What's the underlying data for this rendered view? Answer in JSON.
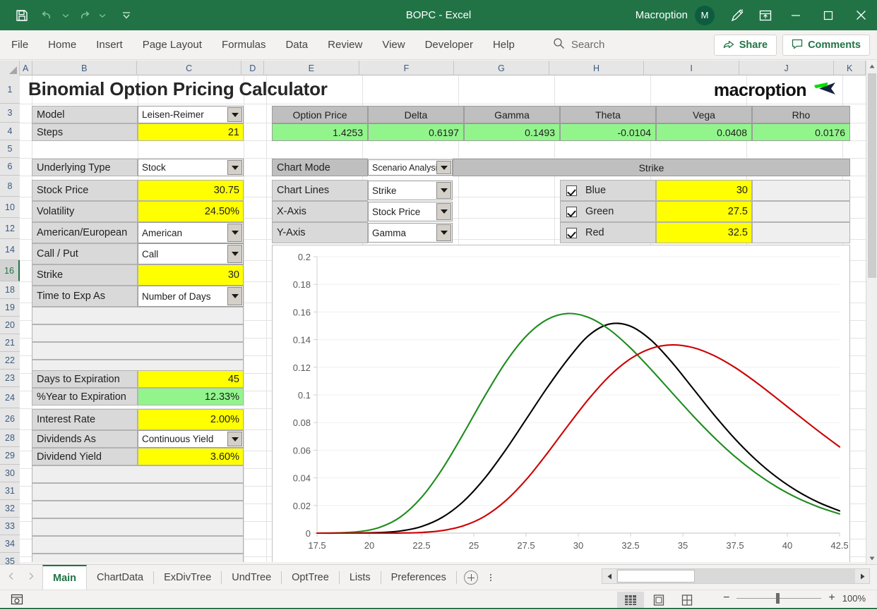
{
  "window": {
    "title": "BOPC  -  Excel",
    "account_name": "Macroption",
    "avatar_initial": "M",
    "quick_access": [
      "save-icon",
      "undo-icon",
      "redo-icon",
      "customize-qat-icon"
    ],
    "buttons": [
      "minimize",
      "maximize",
      "close"
    ]
  },
  "ribbon": {
    "tabs": [
      "File",
      "Home",
      "Insert",
      "Page Layout",
      "Formulas",
      "Data",
      "Review",
      "View",
      "Developer",
      "Help"
    ],
    "search_placeholder": "Search",
    "share_label": "Share",
    "comments_label": "Comments"
  },
  "grid": {
    "columns": [
      "A",
      "B",
      "C",
      "D",
      "E",
      "F",
      "G",
      "H",
      "I",
      "J",
      "K"
    ],
    "rows": [
      "1",
      "3",
      "4",
      "5",
      "6",
      "8",
      "10",
      "12",
      "14",
      "16",
      "18",
      "19",
      "20",
      "21",
      "22",
      "23",
      "24",
      "26",
      "28",
      "29",
      "30",
      "31",
      "32",
      "33",
      "34",
      "35"
    ],
    "selected_row": "16"
  },
  "sheet": {
    "title": "Binomial Option Pricing Calculator",
    "logo_text": "macroption"
  },
  "inputs": [
    {
      "label": "Model",
      "value": "Leisen-Reimer",
      "type": "dropdown"
    },
    {
      "label": "Steps",
      "value": "21",
      "type": "yellow"
    },
    {
      "label": "Underlying Type",
      "value": "Stock",
      "type": "dropdown"
    },
    {
      "label": "Stock Price",
      "value": "30.75",
      "type": "yellow"
    },
    {
      "label": "Volatility",
      "value": "24.50%",
      "type": "yellow"
    },
    {
      "label": "American/European",
      "value": "American",
      "type": "dropdown"
    },
    {
      "label": "Call / Put",
      "value": "Call",
      "type": "dropdown"
    },
    {
      "label": "Strike",
      "value": "30",
      "type": "yellow"
    },
    {
      "label": "Time to Exp As",
      "value": "Number of Days",
      "type": "dropdown"
    },
    {
      "label": "Days to Expiration",
      "value": "45",
      "type": "yellow"
    },
    {
      "label": "%Year to Expiration",
      "value": "12.33%",
      "type": "green"
    },
    {
      "label": "Interest Rate",
      "value": "2.00%",
      "type": "yellow"
    },
    {
      "label": "Dividends As",
      "value": "Continuous Yield",
      "type": "dropdown"
    },
    {
      "label": "Dividend Yield",
      "value": "3.60%",
      "type": "yellow"
    }
  ],
  "results": {
    "headers": [
      "Option Price",
      "Delta",
      "Gamma",
      "Theta",
      "Vega",
      "Rho"
    ],
    "values": [
      "1.4253",
      "0.6197",
      "0.1493",
      "-0.0104",
      "0.0408",
      "0.0176"
    ]
  },
  "chart_controls": [
    {
      "label": "Chart Mode",
      "value": "Scenario Analysis"
    },
    {
      "label": "Chart Lines",
      "value": "Strike"
    },
    {
      "label": "X-Axis",
      "value": "Stock Price"
    },
    {
      "label": "Y-Axis",
      "value": "Gamma"
    }
  ],
  "series_panel": {
    "header": "Strike",
    "rows": [
      {
        "name": "Blue",
        "value": "30",
        "checked": true
      },
      {
        "name": "Green",
        "value": "27.5",
        "checked": true
      },
      {
        "name": "Red",
        "value": "32.5",
        "checked": true
      }
    ]
  },
  "chart_data": {
    "type": "line",
    "title": "",
    "xlabel": "Stock Price",
    "ylabel": "Gamma",
    "xlim": [
      17.5,
      42.5
    ],
    "ylim": [
      0,
      0.2
    ],
    "xticks": [
      "17.5",
      "20",
      "22.5",
      "25",
      "27.5",
      "30",
      "32.5",
      "35",
      "37.5",
      "40",
      "42.5"
    ],
    "yticks": [
      "0",
      "0.02",
      "0.04",
      "0.06",
      "0.08",
      "0.1",
      "0.12",
      "0.14",
      "0.16",
      "0.18",
      "0.2"
    ],
    "grid": true,
    "legend": "none",
    "x": [
      17.5,
      18.5,
      19.5,
      20.5,
      21.5,
      22.5,
      23.5,
      24.5,
      25.5,
      26.5,
      27.5,
      28.5,
      29.5,
      30.5,
      31.5,
      32.5,
      33.5,
      34.5,
      35.5,
      36.5,
      37.5,
      38.5,
      39.5,
      40.5,
      41.5,
      42.5
    ],
    "series": [
      {
        "name": "Blue",
        "color": "#000000",
        "strike": 30,
        "values": [
          0.0,
          0.0,
          0.0001,
          0.0004,
          0.0016,
          0.0048,
          0.0115,
          0.0229,
          0.0393,
          0.0597,
          0.0823,
          0.105,
          0.1258,
          0.143,
          0.1513,
          0.1497,
          0.1394,
          0.1232,
          0.1044,
          0.0855,
          0.0681,
          0.053,
          0.0404,
          0.0302,
          0.0222,
          0.0161
        ]
      },
      {
        "name": "Green",
        "color": "#1e8c1e",
        "strike": 27.5,
        "values": [
          0.0,
          0.0002,
          0.0011,
          0.0042,
          0.0118,
          0.0259,
          0.0466,
          0.0719,
          0.0985,
          0.1231,
          0.1424,
          0.1545,
          0.1589,
          0.156,
          0.1471,
          0.1339,
          0.1181,
          0.1013,
          0.0847,
          0.0692,
          0.0553,
          0.0434,
          0.0334,
          0.0253,
          0.0189,
          0.0139
        ]
      },
      {
        "name": "Red",
        "color": "#cc0000",
        "strike": 32.5,
        "values": [
          0.0,
          0.0,
          0.0,
          0.0,
          0.0001,
          0.0005,
          0.0019,
          0.0053,
          0.012,
          0.0231,
          0.0386,
          0.0575,
          0.0777,
          0.0971,
          0.1138,
          0.1262,
          0.1337,
          0.1362,
          0.1342,
          0.1284,
          0.1198,
          0.1092,
          0.0975,
          0.0855,
          0.0737,
          0.0624
        ]
      }
    ]
  },
  "sheet_tabs": {
    "items": [
      "Main",
      "ChartData",
      "ExDivTree",
      "UndTree",
      "OptTree",
      "Lists",
      "Preferences"
    ],
    "active": "Main",
    "add_label": "add-sheet"
  },
  "status_bar": {
    "zoom": "100%",
    "views": [
      "normal-view",
      "page-layout-view",
      "page-break-view"
    ]
  }
}
